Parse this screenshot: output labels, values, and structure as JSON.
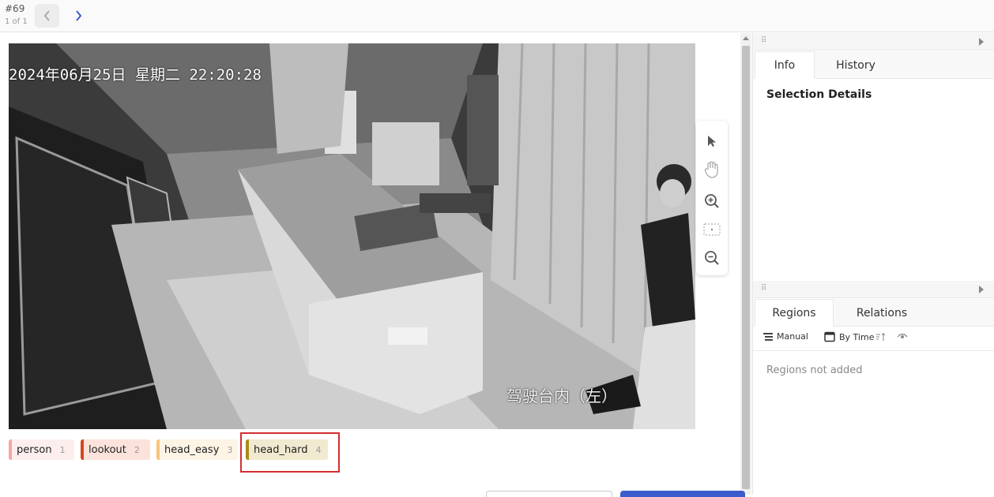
{
  "header": {
    "task_id": "#69",
    "task_count": "1 of 1"
  },
  "image": {
    "timestamp": "2024年06月25日 星期二 22:20:28",
    "caption": "驾驶台内（左）"
  },
  "toolbar": {
    "tools": [
      "select-icon",
      "pan-hand-icon",
      "zoom-in-icon",
      "fit-to-screen-icon",
      "zoom-out-icon"
    ]
  },
  "labels": [
    {
      "name": "person",
      "hotkey": "1",
      "color": "#f4a6a6",
      "bg": "#fdeeee"
    },
    {
      "name": "lookout",
      "hotkey": "2",
      "color": "#d9441c",
      "bg": "#fbe3dc"
    },
    {
      "name": "head_easy",
      "hotkey": "3",
      "color": "#f7c47a",
      "bg": "#fdf4e6"
    },
    {
      "name": "head_hard",
      "hotkey": "4",
      "color": "#a88a17",
      "bg": "#f1ead1"
    }
  ],
  "sidebar": {
    "top_tabs": [
      "Info",
      "History"
    ],
    "selection_title": "Selection Details",
    "bottom_tabs": [
      "Regions",
      "Relations"
    ],
    "tools": {
      "manual": "Manual",
      "by_time": "By Time"
    },
    "empty_message": "Regions not added"
  }
}
